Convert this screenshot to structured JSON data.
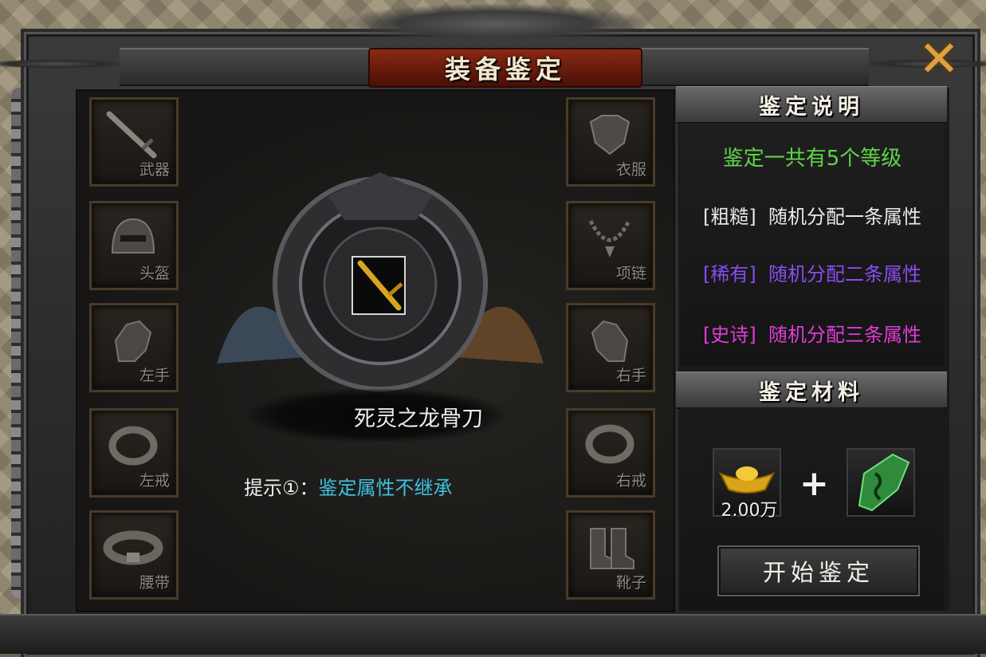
{
  "window": {
    "title": "装备鉴定",
    "close_icon": "close-x-icon"
  },
  "slots_left": [
    {
      "label": "武器",
      "icon": "sword-icon"
    },
    {
      "label": "头盔",
      "icon": "helmet-icon"
    },
    {
      "label": "左手",
      "icon": "gauntlet-icon"
    },
    {
      "label": "左戒",
      "icon": "ring-icon"
    },
    {
      "label": "腰带",
      "icon": "belt-icon"
    }
  ],
  "slots_right": [
    {
      "label": "衣服",
      "icon": "armor-icon"
    },
    {
      "label": "项链",
      "icon": "necklace-icon"
    },
    {
      "label": "右手",
      "icon": "gauntlet-icon"
    },
    {
      "label": "右戒",
      "icon": "ring-icon"
    },
    {
      "label": "靴子",
      "icon": "boots-icon"
    }
  ],
  "center": {
    "item_name": "死灵之龙骨刀",
    "hint_label": "提示①：",
    "hint_value": "鉴定属性不继承"
  },
  "info": {
    "header": "鉴定说明",
    "summary": "鉴定一共有5个等级",
    "grades": [
      {
        "tag": "[粗糙]",
        "desc": "随机分配一条属性",
        "color": "#e8e8e8"
      },
      {
        "tag": "[稀有]",
        "desc": "随机分配二条属性",
        "color": "#8a4cf0"
      },
      {
        "tag": "[史诗]",
        "desc": "随机分配三条属性",
        "color": "#e03cd8"
      }
    ],
    "summary_color": "#5fd64a"
  },
  "materials": {
    "header": "鉴定材料",
    "gold_amount": "2.00万",
    "gold_icon": "gold-ingot-icon",
    "plus": "+",
    "jade_icon": "jade-talisman-icon",
    "start_button": "开始鉴定"
  }
}
